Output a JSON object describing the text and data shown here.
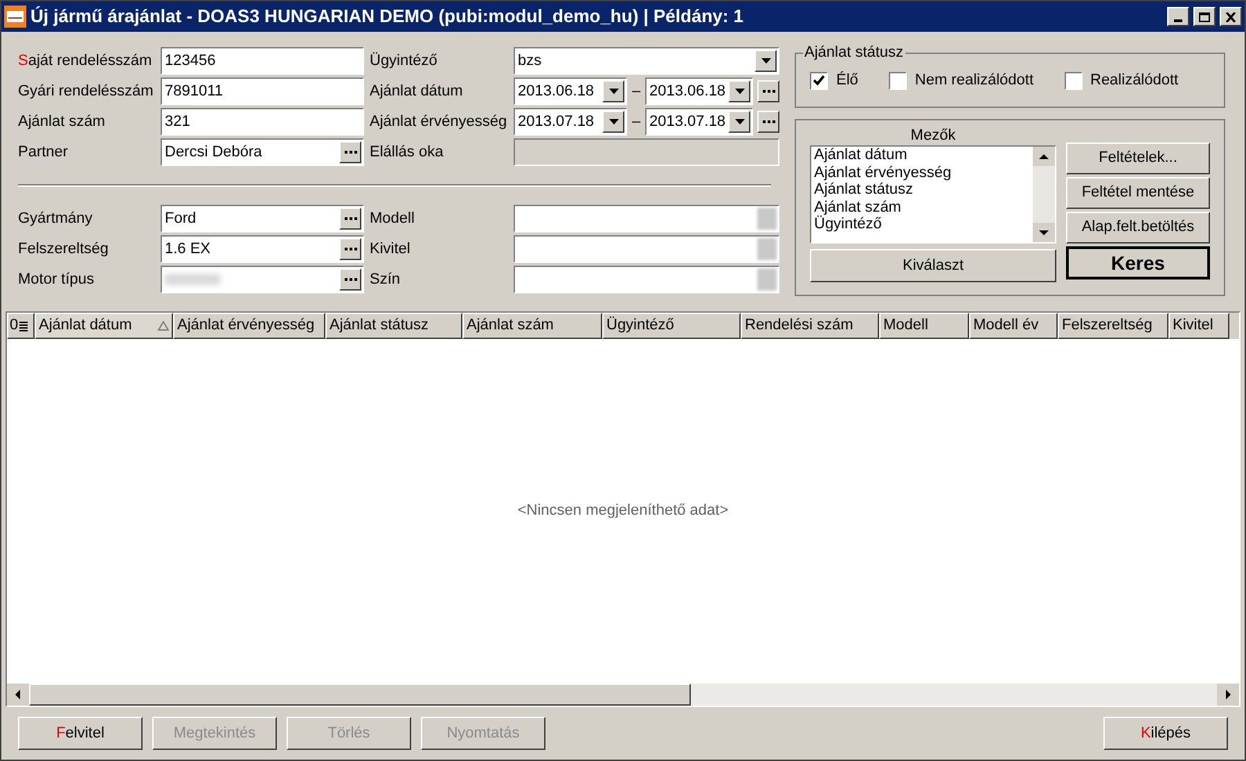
{
  "window": {
    "title": "Új jármű árajánlat - DOAS3 HUNGARIAN DEMO (pubi:modul_demo_hu) | Példány: 1"
  },
  "left_top": [
    {
      "label": "Saját rendelésszám",
      "hotkey": true,
      "kind": "text",
      "value": "123456"
    },
    {
      "label": "Gyári rendelésszám",
      "hotkey": false,
      "kind": "text",
      "value": "7891011"
    },
    {
      "label": "Ajánlat szám",
      "hotkey": false,
      "kind": "text",
      "value": "321"
    },
    {
      "label": "Partner",
      "hotkey": false,
      "kind": "lookup",
      "value": "Dercsi Debóra"
    }
  ],
  "right_top": [
    {
      "label": "Ügyintéző",
      "kind": "combo",
      "value": "bzs"
    },
    {
      "label": "Ajánlat dátum",
      "kind": "range",
      "from": "2013.06.18",
      "to": "2013.06.18",
      "separator": "–"
    },
    {
      "label": "Ajánlat érvényesség",
      "kind": "range",
      "from": "2013.07.18",
      "to": "2013.07.18",
      "separator": "–"
    },
    {
      "label": "Elállás oka",
      "kind": "disabled"
    }
  ],
  "left_bottom": [
    {
      "label": "Gyártmány",
      "hotkey": false,
      "kind": "lookup",
      "value": "Ford"
    },
    {
      "label": "Felszereltség",
      "hotkey": false,
      "kind": "lookup",
      "value": "1.6 EX"
    },
    {
      "label": "Motor típus",
      "hotkey": false,
      "kind": "blurred_lookup"
    }
  ],
  "right_bottom": [
    {
      "label": "Modell",
      "kind": "blurred"
    },
    {
      "label": "Kivitel",
      "kind": "blurred"
    },
    {
      "label": "Szín",
      "kind": "blurred"
    }
  ],
  "status": {
    "title": "Ajánlat státusz",
    "options": [
      {
        "label": "Élő",
        "checked": true
      },
      {
        "label": "Nem realizálódott",
        "checked": false
      },
      {
        "label": "Realizálódott",
        "checked": false
      }
    ]
  },
  "fields_panel": {
    "title": "Mezők",
    "items": [
      "Ajánlat dátum",
      "Ajánlat érvényesség",
      "Ajánlat státusz",
      "Ajánlat szám",
      "Ügyintéző"
    ],
    "buttons": [
      "Feltételek...",
      "Feltétel mentése",
      "Alap.felt.betöltés"
    ],
    "select_button": "Kiválaszt",
    "search_button": "Keres"
  },
  "table": {
    "count": "0",
    "columns": [
      {
        "label": "Ajánlat dátum",
        "sorted": true
      },
      {
        "label": "Ajánlat érvényesség",
        "sorted": false
      },
      {
        "label": "Ajánlat státusz",
        "sorted": false
      },
      {
        "label": "Ajánlat szám",
        "sorted": false
      },
      {
        "label": "Ügyintéző",
        "sorted": false
      },
      {
        "label": "Rendelési szám",
        "sorted": false
      },
      {
        "label": "Modell",
        "sorted": false
      },
      {
        "label": "Modell év",
        "sorted": false
      },
      {
        "label": "Felszereltség",
        "sorted": false
      },
      {
        "label": "Kivitel",
        "sorted": false
      }
    ],
    "empty_text": "<Nincsen megjeleníthető adat>"
  },
  "footer": {
    "buttons": [
      {
        "label": "Felvitel",
        "disabled": false,
        "hotkey": true
      },
      {
        "label": "Megtekintés",
        "disabled": true,
        "hotkey": false
      },
      {
        "label": "Törlés",
        "disabled": true,
        "hotkey": false
      },
      {
        "label": "Nyomtatás",
        "disabled": true,
        "hotkey": false
      }
    ],
    "exit": {
      "label": "Kilépés",
      "disabled": false,
      "hotkey": true
    }
  }
}
